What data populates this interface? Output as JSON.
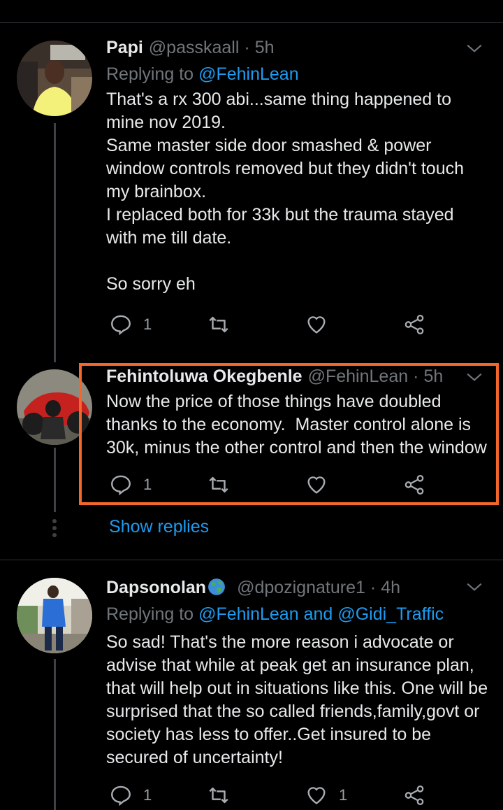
{
  "tweets": [
    {
      "name": "Papi",
      "handle": "@passkaall",
      "time": "5h",
      "replying_label": "Replying to",
      "replying_to": [
        "@FehinLean"
      ],
      "text": "That's a rx 300 abi...same thing happened to mine nov 2019.\nSame master side door smashed & power window controls removed but they didn't touch my brainbox.\nI replaced both for 33k but the trauma stayed with me till date.\n\nSo sorry eh",
      "reply_count": "1",
      "retweet_count": "",
      "like_count": ""
    },
    {
      "name": "Fehintoluwa Okegbenle",
      "handle": "@FehinLean",
      "time": "5h",
      "text": "Now the price of those things have doubled thanks to the economy.  Master control alone is 30k, minus the other control and then the window",
      "reply_count": "1",
      "retweet_count": "",
      "like_count": ""
    },
    {
      "name": "Dapsonolan",
      "name_emoji": "globe-icon",
      "handle": "@dpozignature1",
      "time": "4h",
      "replying_label": "Replying to",
      "replying_to": [
        "@FehinLean",
        "@Gidi_Traffic"
      ],
      "replying_joiner": "and",
      "text": "So sad! That's the more reason i advocate or advise that while at peak get an insurance plan, that will help out in situations like this. One will be surprised that the so called friends,family,govt or society has less to offer..Get insured to be secured of uncertainty!",
      "reply_count": "1",
      "retweet_count": "",
      "like_count": "1"
    }
  ],
  "show_replies_label": "Show replies",
  "colors": {
    "background": "#000000",
    "link": "#1d9bf0",
    "muted": "#71767b",
    "text": "#e7e9ea",
    "highlight": "#f4672a",
    "thread_line": "#3d4145"
  }
}
